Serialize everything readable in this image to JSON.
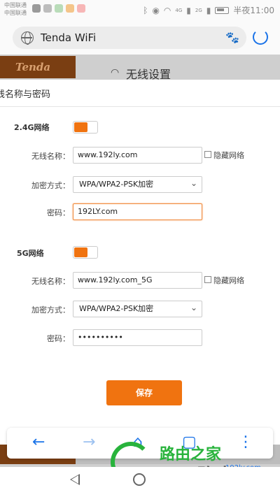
{
  "status_bar": {
    "carrier1": "中国联通",
    "carrier2": "中国联通",
    "net1": "4G",
    "net2": "2G",
    "time": "半夜11:00"
  },
  "browser": {
    "url_text": "Tenda WiFi"
  },
  "page": {
    "logo_text": "Tenda",
    "header_title": "无线设置"
  },
  "modal": {
    "title": "线名称与密码",
    "band24": {
      "section": "2.4G网络",
      "ssid_label": "无线名称：",
      "ssid_value": "www.192ly.com",
      "hide_label": "隐藏网络",
      "security_label": "加密方式：",
      "security_value": "WPA/WPA2-PSK加密",
      "password_label": "密码：",
      "password_value": "192LY.com"
    },
    "band5": {
      "section": "5G网络",
      "ssid_label": "无线名称：",
      "ssid_value": "www.192ly.com_5G",
      "hide_label": "隐藏网络",
      "security_label": "加密方式：",
      "security_value": "WPA/WPA2-PSK加密",
      "password_label": "密码：",
      "password_value": "••••••••••"
    },
    "save_label": "保存"
  },
  "watermark": {
    "line1": "路由之家",
    "line2": "191路由网",
    "line3": "192ly.com"
  },
  "colors": {
    "accent": "#f07310",
    "browser_blue": "#1a73e8",
    "watermark_green": "#28b33c"
  }
}
